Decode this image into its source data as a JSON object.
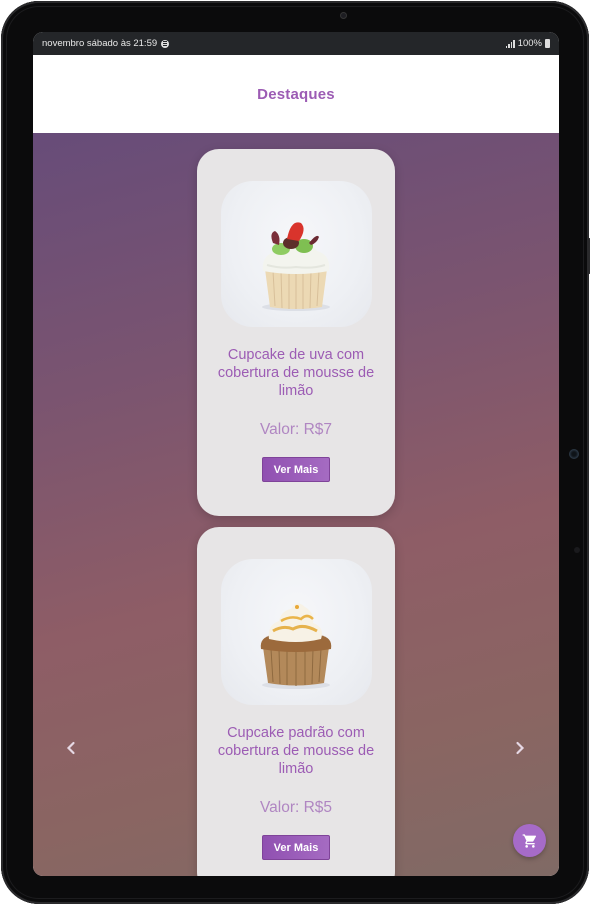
{
  "statusbar": {
    "time_text": "novembro sábado às 21:59",
    "battery_text": "100%",
    "icons": [
      "spotify-icon",
      "signal-icon",
      "battery-icon"
    ]
  },
  "header": {
    "title": "Destaques"
  },
  "products": [
    {
      "name": "Cupcake de uva com cobertura de mousse de limão",
      "price": "Valor: R$7",
      "button": "Ver Mais",
      "image": "cupcake-strawberry-image"
    },
    {
      "name": "Cupcake padrão com cobertura de mousse de limão",
      "price": "Valor: R$5",
      "button": "Ver Mais",
      "image": "cupcake-caramel-image"
    }
  ],
  "carousel": {
    "prev_icon": "chevron-left-icon",
    "next_icon": "chevron-right-icon"
  },
  "cart": {
    "icon": "cart-icon"
  },
  "colors": {
    "accent": "#9c5cb4",
    "header_bg": "#ffffff",
    "card_bg": "#e7e5e6",
    "button": "#9050b1",
    "statusbar_bg": "#242629"
  }
}
